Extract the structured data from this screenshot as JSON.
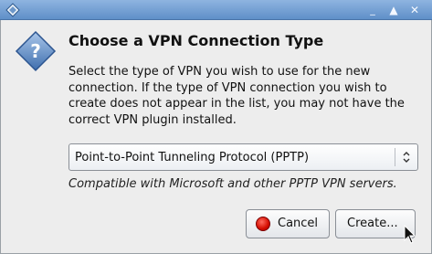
{
  "window": {
    "icons": {
      "app": "diamond-app-icon",
      "minimize": "minimize-icon",
      "maximize": "maximize-icon",
      "close": "close-icon"
    },
    "glyphs": {
      "minimize": "_",
      "maximize": "▲",
      "close": "✕"
    }
  },
  "dialog": {
    "icon": "question-icon",
    "heading": "Choose a VPN Connection Type",
    "description": "Select the type of VPN you wish to use for the new\nconnection.  If the type of VPN connection you wish to\ncreate does not appear in the list, you may not have the\ncorrect VPN plugin installed.",
    "vpn_type": {
      "selected": "Point-to-Point Tunneling Protocol (PPTP)",
      "arrow_icon": "updown-arrow-icon"
    },
    "hint": "Compatible with Microsoft and other PPTP VPN servers.",
    "buttons": {
      "cancel": {
        "label": "Cancel",
        "icon": "cancel-icon",
        "color": "#d40d00"
      },
      "create": {
        "label": "Create..."
      }
    }
  },
  "colors": {
    "titlebar_top": "#8eb4e0",
    "titlebar_bottom": "#5f8fc8",
    "background": "#ededed",
    "icon_blue": "#4f7fbf"
  }
}
